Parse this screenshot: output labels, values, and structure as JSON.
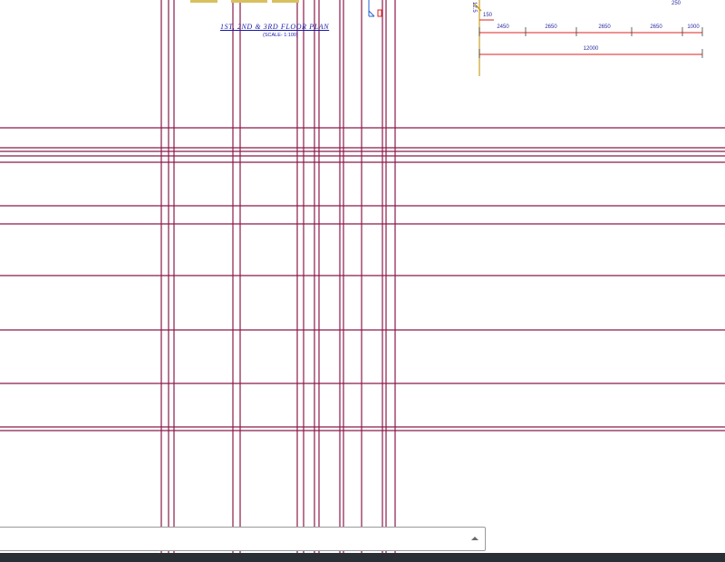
{
  "drawing": {
    "title": "1ST, 2ND & 3RD FLOOR PLAN",
    "scale": "(SCALE- 1:100)",
    "small_labels": [
      "150",
      "250",
      "12.5"
    ],
    "dimensions": {
      "segments": [
        "2450",
        "2650",
        "2650",
        "2650",
        "1000"
      ],
      "total": "12000"
    },
    "colors": {
      "grid_line": "#8b1a4a",
      "dimension_line": "#e02020",
      "text": "#1a1aa8",
      "axis": "#c8a020"
    }
  },
  "command_line": {
    "placeholder": "",
    "history_icon": "triangle-up-icon"
  }
}
